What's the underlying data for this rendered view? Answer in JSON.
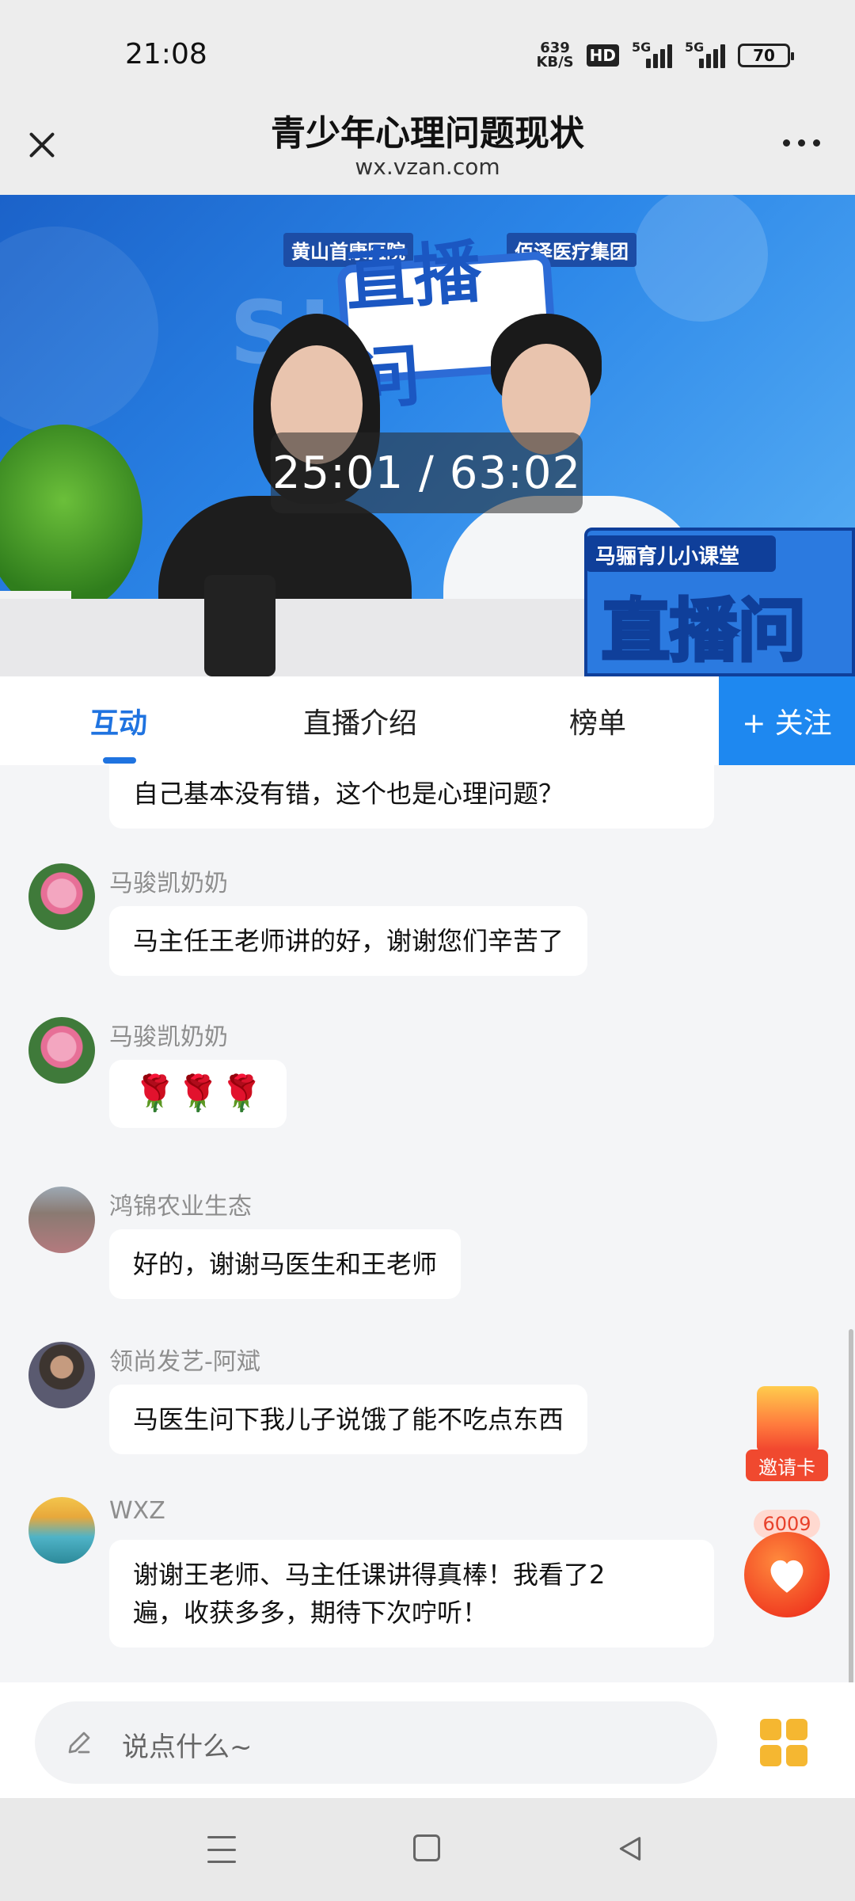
{
  "status_bar": {
    "time": "21:08",
    "net_speed_value": "639",
    "net_speed_unit": "KB/S",
    "hd_label": "HD",
    "signal1_label": "5G",
    "signal2_label": "5G",
    "battery": "70"
  },
  "header": {
    "title": "青少年心理问题现状",
    "domain": "wx.vzan.com"
  },
  "video": {
    "time": "25:01 / 63:02",
    "sponsor_left": "黄山首康医院",
    "sponsor_right": "佰泽医疗集团",
    "logo_text": "直播问",
    "bg_text": "SH      IG",
    "banner_top": "马骊育儿小课堂",
    "banner_big": "直播问"
  },
  "tabs": [
    {
      "label": "互动"
    },
    {
      "label": "直播介绍"
    },
    {
      "label": "榜单"
    }
  ],
  "follow_label": "+ 关注",
  "messages": [
    {
      "nick": "",
      "text": "自己基本没有错，这个也是心理问题？"
    },
    {
      "nick": "马骏凯奶奶",
      "text": "马主任王老师讲的好，谢谢您们辛苦了"
    },
    {
      "nick": "马骏凯奶奶",
      "text": "🌹🌹🌹"
    },
    {
      "nick": "鸿锦农业生态",
      "text": "好的，谢谢马医生和王老师"
    },
    {
      "nick": "领尚发艺-阿斌",
      "text": "马医生问下我儿子说饿了能不吃点东西"
    },
    {
      "nick": "WXZ",
      "text_line1": "谢谢王老师、马主任课讲得真棒！我看了2",
      "text_line2": "遍，收获多多，期待下次咛听！"
    }
  ],
  "invite_label": "邀请卡",
  "like_count": "6009",
  "input": {
    "placeholder": "说点什么~"
  },
  "colors": {
    "accent": "#1f73e0",
    "follow_bg": "#1e88f0",
    "like": "#f03b20"
  }
}
